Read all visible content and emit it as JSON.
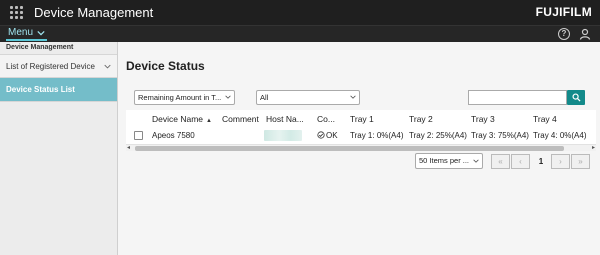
{
  "header": {
    "app_title": "Device Management",
    "brand": "FUJIFILM",
    "apps_icon": "grid-apps-icon",
    "help_label": "?",
    "user_icon": "user-icon"
  },
  "menubar": {
    "menu_label": "Menu"
  },
  "sidebar": {
    "section_title": "Device Management",
    "items": [
      {
        "label": "List of Registered Device",
        "expandable": true,
        "active": false
      },
      {
        "label": "Device Status List",
        "expandable": false,
        "active": true
      }
    ]
  },
  "main": {
    "title": "Device Status",
    "filters": {
      "category_value": "Remaining Amount in T...",
      "scope_value": "All",
      "search_value": ""
    },
    "table": {
      "columns": [
        "Device Name",
        "Comment",
        "Host Na...",
        "Co...",
        "Tray 1",
        "Tray 2",
        "Tray 3",
        "Tray 4"
      ],
      "sort_indicator": "▲",
      "rows": [
        {
          "device_name": "Apeos 7580",
          "comment": "",
          "host_name": "",
          "status": "OK",
          "tray1": "Tray 1: 0%(A4)",
          "tray2": "Tray 2: 25%(A4)",
          "tray3": "Tray 3: 75%(A4)",
          "tray4": "Tray 4: 0%(A4)"
        }
      ]
    },
    "pager": {
      "items_per_page": "50 Items per ...",
      "first": "«",
      "prev": "‹",
      "current_page": "1",
      "next": "›",
      "last": "»"
    }
  },
  "colors": {
    "topbar": "#1f1f1f",
    "accent": "#5cc7d6",
    "sidebar_active": "#74bdc9",
    "search_button": "#138a8a",
    "ok_green": "#2e8b57"
  }
}
